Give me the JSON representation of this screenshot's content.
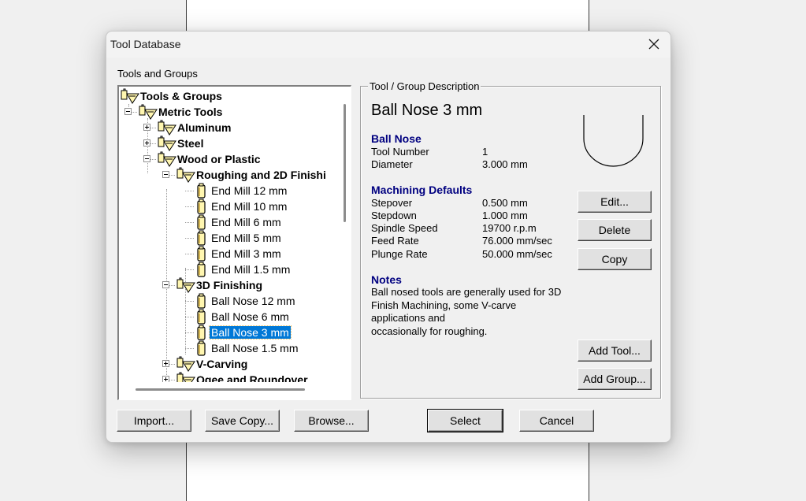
{
  "dialog": {
    "title": "Tool Database"
  },
  "tree_section": {
    "label": "Tools and Groups",
    "nodes": [
      {
        "label": "Tools & Groups"
      },
      {
        "label": "Metric Tools"
      },
      {
        "label": "Aluminum"
      },
      {
        "label": "Steel"
      },
      {
        "label": "Wood or Plastic"
      },
      {
        "label": "Roughing and 2D Finishi"
      },
      {
        "label": "End Mill 12 mm"
      },
      {
        "label": "End Mill 10 mm"
      },
      {
        "label": "End Mill 6 mm"
      },
      {
        "label": "End Mill 5 mm"
      },
      {
        "label": "End Mill 3 mm"
      },
      {
        "label": "End Mill 1.5 mm"
      },
      {
        "label": "3D Finishing"
      },
      {
        "label": "Ball Nose 12 mm"
      },
      {
        "label": "Ball Nose 6 mm"
      },
      {
        "label": "Ball Nose 3 mm"
      },
      {
        "label": "Ball Nose 1.5 mm"
      },
      {
        "label": "V-Carving"
      },
      {
        "label": "Ogee and Roundover"
      }
    ]
  },
  "description": {
    "legend": "Tool / Group Description",
    "tool_name": "Ball Nose 3 mm",
    "tool_type": "Ball Nose",
    "tool_number_label": "Tool Number",
    "tool_number": "1",
    "diameter_label": "Diameter",
    "diameter": "3.000 mm",
    "machining_title": "Machining Defaults",
    "stepover_label": "Stepover",
    "stepover": "0.500 mm",
    "stepdown_label": "Stepdown",
    "stepdown": "1.000 mm",
    "spindle_label": "Spindle Speed",
    "spindle": "19700 r.p.m",
    "feed_label": "Feed Rate",
    "feed": "76.000 mm/sec",
    "plunge_label": "Plunge Rate",
    "plunge": "50.000 mm/sec",
    "notes_title": "Notes",
    "notes_lines": [
      "Ball nosed tools are generally used for 3D",
      "Finish Machining, some V-carve",
      "applications and",
      "occasionally for roughing."
    ]
  },
  "buttons": {
    "edit": "Edit...",
    "delete": "Delete",
    "copy": "Copy",
    "add_tool": "Add Tool...",
    "add_group": "Add Group...",
    "import": "Import...",
    "save_copy": "Save Copy...",
    "browse": "Browse...",
    "select": "Select",
    "cancel": "Cancel"
  },
  "colors": {
    "section_heading": "#000080",
    "selection": "#0078d7",
    "tool_icon_fill": "#fff6b0"
  }
}
